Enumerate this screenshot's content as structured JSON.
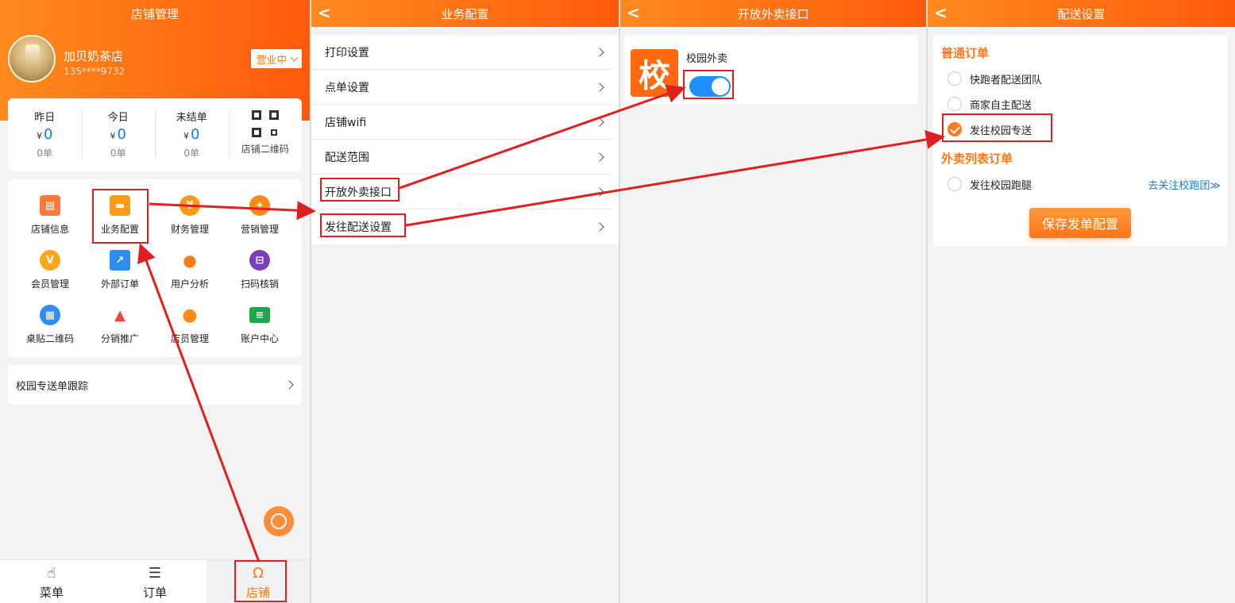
{
  "colors": {
    "brand_orange": "#ff7a1a",
    "link_blue": "#1e7ad6",
    "toggle_blue": "#1e90ff",
    "annotation_red": "#e02020"
  },
  "store_panel": {
    "title": "店铺管理",
    "store_name": "加贝奶茶店",
    "phone": "135****9732",
    "status": "营业中",
    "stats": [
      {
        "label": "昨日",
        "currency": "¥",
        "amount": "0",
        "orders": "0单"
      },
      {
        "label": "今日",
        "currency": "¥",
        "amount": "0",
        "orders": "0单"
      },
      {
        "label": "未结单",
        "currency": "¥",
        "amount": "0",
        "orders": "0单"
      }
    ],
    "qr_label": "店铺二维码",
    "grid": [
      {
        "label": "店铺信息",
        "icon": "store-icon",
        "color": "#ff7a3a"
      },
      {
        "label": "业务配置",
        "icon": "briefcase-icon",
        "color": "#ff9a1a"
      },
      {
        "label": "财务管理",
        "icon": "yen-icon",
        "color": "#ff9a1a"
      },
      {
        "label": "营销管理",
        "icon": "megaphone-icon",
        "color": "#ff8a1a"
      },
      {
        "label": "会员管理",
        "icon": "vip-icon",
        "color": "#ffa51a"
      },
      {
        "label": "外部订单",
        "icon": "external-order-icon",
        "color": "#2f8cf0"
      },
      {
        "label": "用户分析",
        "icon": "user-analysis-icon",
        "color": "#ff7a1a"
      },
      {
        "label": "扫码核销",
        "icon": "scan-icon",
        "color": "#7a3fb8"
      },
      {
        "label": "桌贴二维码",
        "icon": "table-qr-icon",
        "color": "#2f8cf0"
      },
      {
        "label": "分销推广",
        "icon": "distribution-icon",
        "color": "#e84a3a"
      },
      {
        "label": "店员管理",
        "icon": "staff-icon",
        "color": "#ff8a1a"
      },
      {
        "label": "账户中心",
        "icon": "account-card-icon",
        "color": "#1aa84a"
      }
    ],
    "track_row": "校园专送单跟踪",
    "tabs": [
      {
        "label": "菜单",
        "icon": "hand-pointer-icon"
      },
      {
        "label": "订单",
        "icon": "order-list-icon"
      },
      {
        "label": "店铺",
        "icon": "store-person-icon"
      }
    ]
  },
  "business_panel": {
    "title": "业务配置",
    "rows": [
      "打印设置",
      "点单设置",
      "店铺wifi",
      "配送范围",
      "开放外卖接口",
      "发往配送设置"
    ]
  },
  "takeout_panel": {
    "title": "开放外卖接口",
    "logo_char": "校",
    "service_name": "校园外卖",
    "enabled": true
  },
  "delivery_panel": {
    "title": "配送设置",
    "section_normal": "普通订单",
    "normal_options": [
      {
        "label": "快跑者配送团队",
        "selected": false
      },
      {
        "label": "商家自主配送",
        "selected": false
      },
      {
        "label": "发往校园专送",
        "selected": true
      }
    ],
    "section_list": "外卖列表订单",
    "list_options": [
      {
        "label": "发往校园跑腿",
        "selected": false
      }
    ],
    "follow_link": "去关注校跑团≫",
    "save_button": "保存发单配置"
  }
}
